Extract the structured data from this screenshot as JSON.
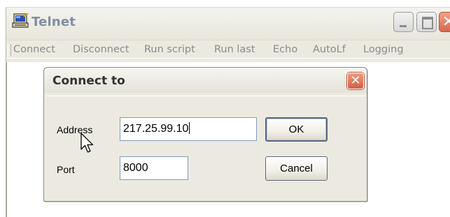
{
  "window": {
    "title": "Telnet",
    "icon": "telnet-app-icon",
    "controls": {
      "minimize_icon": "minimize-icon",
      "maximize_icon": "maximize-icon",
      "close_icon": "close-icon",
      "close_glyph": "✕"
    }
  },
  "menu": {
    "items": [
      "Connect",
      "Disconnect",
      "Run script",
      "Run last",
      "Echo",
      "AutoLf",
      "Logging"
    ]
  },
  "dialog": {
    "title": "Connect to",
    "close_glyph": "✕",
    "address_label": "Address",
    "address_value": "217.25.99.10",
    "port_label": "Port",
    "port_value": "8000",
    "ok_label": "OK",
    "cancel_label": "Cancel"
  },
  "colors": {
    "window_bg": "#eceae0",
    "title_text": "#7d8ea4",
    "close_button": "#d56a4e",
    "textbox_border": "#7f9db9"
  }
}
